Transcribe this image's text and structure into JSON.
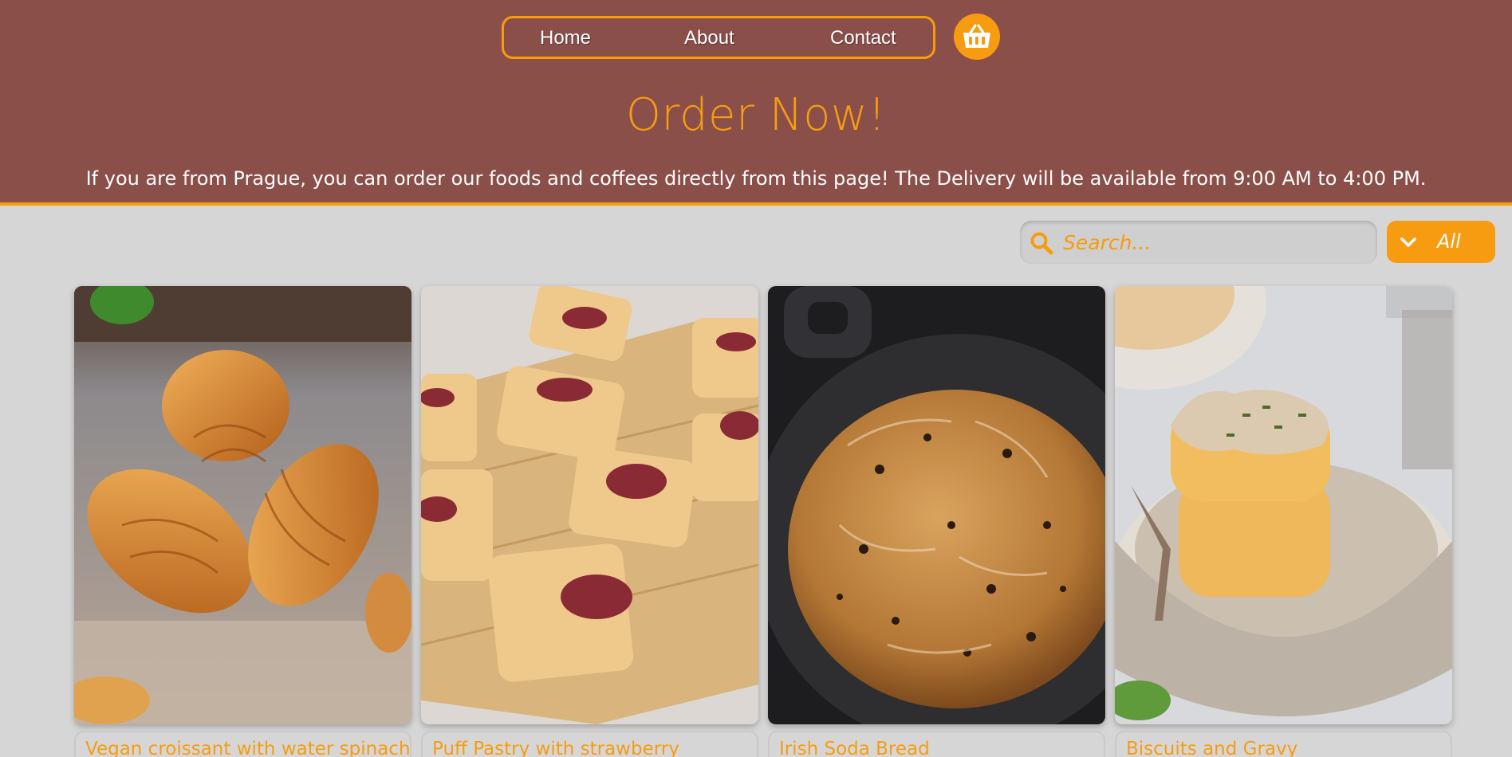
{
  "nav": {
    "items": [
      {
        "label": "Home"
      },
      {
        "label": "About"
      },
      {
        "label": "Contact"
      }
    ],
    "cart_icon": "basket-icon"
  },
  "hero": {
    "title": "Order Now!",
    "subtitle": "If you are from Prague, you can order our foods and coffees directly from this page! The Delivery will be available from 9:00 AM to 4:00 PM."
  },
  "toolbar": {
    "search_placeholder": "Search...",
    "search_icon": "search-icon",
    "filter_value": "All",
    "filter_icon": "chevron-down-icon"
  },
  "products": [
    {
      "name": "Vegan croissant with water spinach",
      "image": "croissants-photo"
    },
    {
      "name": "Puff Pastry with strawberry",
      "image": "puff-pastry-photo"
    },
    {
      "name": "Irish Soda Bread",
      "image": "soda-bread-photo"
    },
    {
      "name": "Biscuits and Gravy",
      "image": "biscuits-gravy-photo"
    }
  ],
  "colors": {
    "header_bg": "#8b4f4a",
    "accent": "#f79c10",
    "page_bg": "#d6d6d6"
  }
}
